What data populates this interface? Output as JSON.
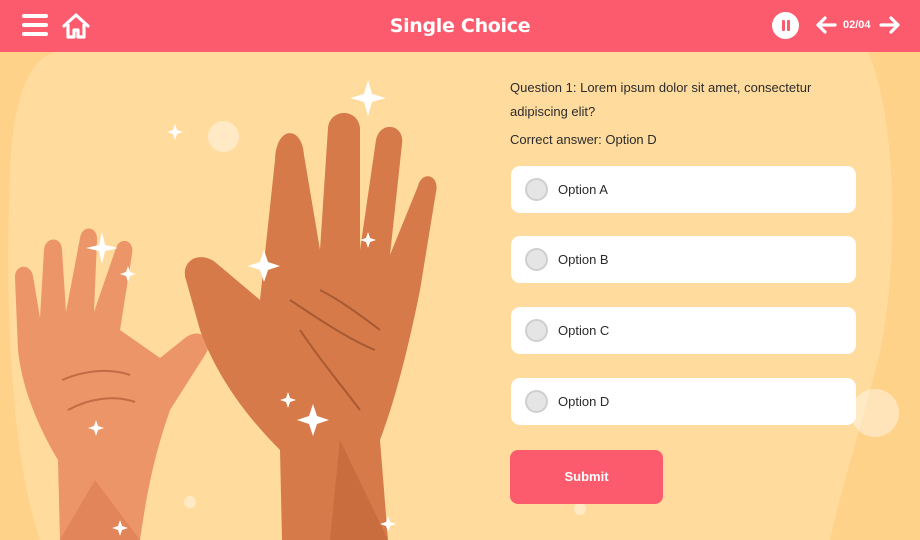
{
  "header": {
    "title": "Single Choice",
    "progress": "02/04",
    "icons": [
      "menu-icon",
      "home-icon",
      "pause-icon",
      "arrow-left-icon",
      "arrow-right-icon"
    ]
  },
  "quiz": {
    "question": "Question 1: Lorem ipsum dolor sit amet, consectetur adipiscing elit?",
    "correct_answer": "Correct answer: Option D",
    "options": [
      {
        "label": "Option A"
      },
      {
        "label": "Option B"
      },
      {
        "label": "Option C"
      },
      {
        "label": "Option D"
      }
    ],
    "submit_label": "Submit"
  },
  "colors": {
    "accent": "#fc5a6d",
    "background": "#ffd28a",
    "background_light": "#ffdc9e"
  }
}
